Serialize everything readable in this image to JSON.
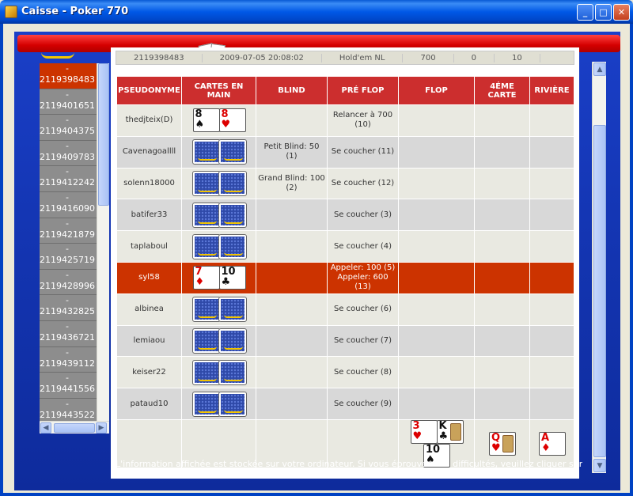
{
  "window": {
    "title": "Caisse - Poker 770"
  },
  "hand_ids": [
    "2119398483",
    "2119401651",
    "2119404375",
    "2119409783",
    "2119412242",
    "2119416090",
    "2119421879",
    "2119425719",
    "2119428996",
    "2119432825",
    "2119436721",
    "2119439112",
    "2119441556",
    "2119443522"
  ],
  "selected_hand_index": 0,
  "top_strip": [
    "2119398483",
    "2009-07-05 20:08:02",
    "Hold'em NL",
    "700",
    "0",
    "10"
  ],
  "table": {
    "headers": {
      "pseudonyme": "PSEUDONYME",
      "cartes": "CARTES EN MAIN",
      "blind": "BLIND",
      "preflop": "PRÉ FLOP",
      "flop": "FLOP",
      "turn": "4ÉME CARTE",
      "river": "RIVIÈRE"
    },
    "rows": [
      {
        "name": "thedjteix(D)",
        "cards": [
          {
            "rank": "8",
            "suit": "♠",
            "color": "black"
          },
          {
            "rank": "8",
            "suit": "♥",
            "color": "red"
          }
        ],
        "blind": "",
        "preflop": "Relancer à 700 (10)",
        "highlight": false
      },
      {
        "name": "Cavenagoallll",
        "cards": "back",
        "blind": "Petit Blind: 50 (1)",
        "preflop": "Se coucher (11)",
        "highlight": false
      },
      {
        "name": "solenn18000",
        "cards": "back",
        "blind": "Grand Blind: 100 (2)",
        "preflop": "Se coucher (12)",
        "highlight": false
      },
      {
        "name": "batifer33",
        "cards": "back",
        "blind": "",
        "preflop": "Se coucher (3)",
        "highlight": false
      },
      {
        "name": "taplaboul",
        "cards": "back",
        "blind": "",
        "preflop": "Se coucher (4)",
        "highlight": false
      },
      {
        "name": "syl58",
        "cards": [
          {
            "rank": "7",
            "suit": "♦",
            "color": "red"
          },
          {
            "rank": "10",
            "suit": "♣",
            "color": "black"
          }
        ],
        "blind": "",
        "preflop": "Appeler: 100 (5) Appeler: 600 (13)",
        "highlight": true
      },
      {
        "name": "albinea",
        "cards": "back",
        "blind": "",
        "preflop": "Se coucher (6)",
        "highlight": false
      },
      {
        "name": "lemiaou",
        "cards": "back",
        "blind": "",
        "preflop": "Se coucher (7)",
        "highlight": false
      },
      {
        "name": "keiser22",
        "cards": "back",
        "blind": "",
        "preflop": "Se coucher (8)",
        "highlight": false
      },
      {
        "name": "pataud10",
        "cards": "back",
        "blind": "",
        "preflop": "Se coucher (9)",
        "highlight": false
      }
    ],
    "board": {
      "flop": [
        {
          "rank": "3",
          "suit": "♥",
          "color": "red"
        },
        {
          "rank": "K",
          "suit": "♣",
          "color": "black"
        },
        {
          "rank": "10",
          "suit": "♠",
          "color": "black"
        }
      ],
      "turn": [
        {
          "rank": "Q",
          "suit": "♥",
          "color": "red"
        }
      ],
      "river": [
        {
          "rank": "A",
          "suit": "♦",
          "color": "red"
        }
      ]
    }
  },
  "footer": "L'information affichée est stockée sur votre ordinateur. Si vous éprouvez des difficultés, veuillez cliquer sur"
}
